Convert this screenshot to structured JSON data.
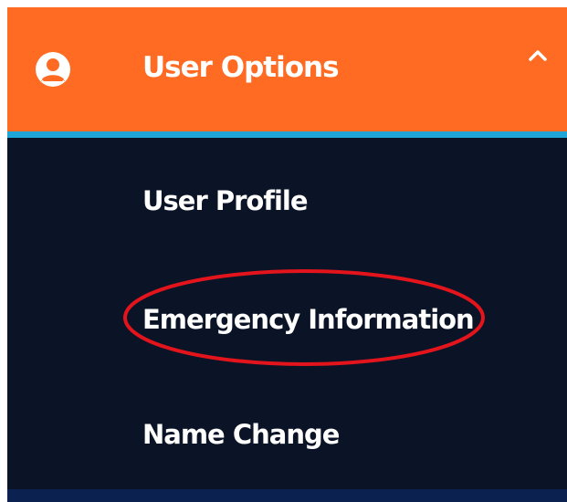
{
  "menu": {
    "header": {
      "title": "User Options",
      "icon": "user-circle-icon",
      "toggle_icon": "chevron-up-icon"
    },
    "items": [
      {
        "label": "User Profile"
      },
      {
        "label": "Emergency Information",
        "highlighted": true
      },
      {
        "label": "Name Change"
      }
    ]
  },
  "colors": {
    "header_bg": "#ff6b22",
    "accent_line": "#1fa6d6",
    "menu_bg": "#0b1427",
    "bottom_strip": "#0b2150",
    "text": "#ffffff",
    "highlight_ring": "#e3141b"
  }
}
